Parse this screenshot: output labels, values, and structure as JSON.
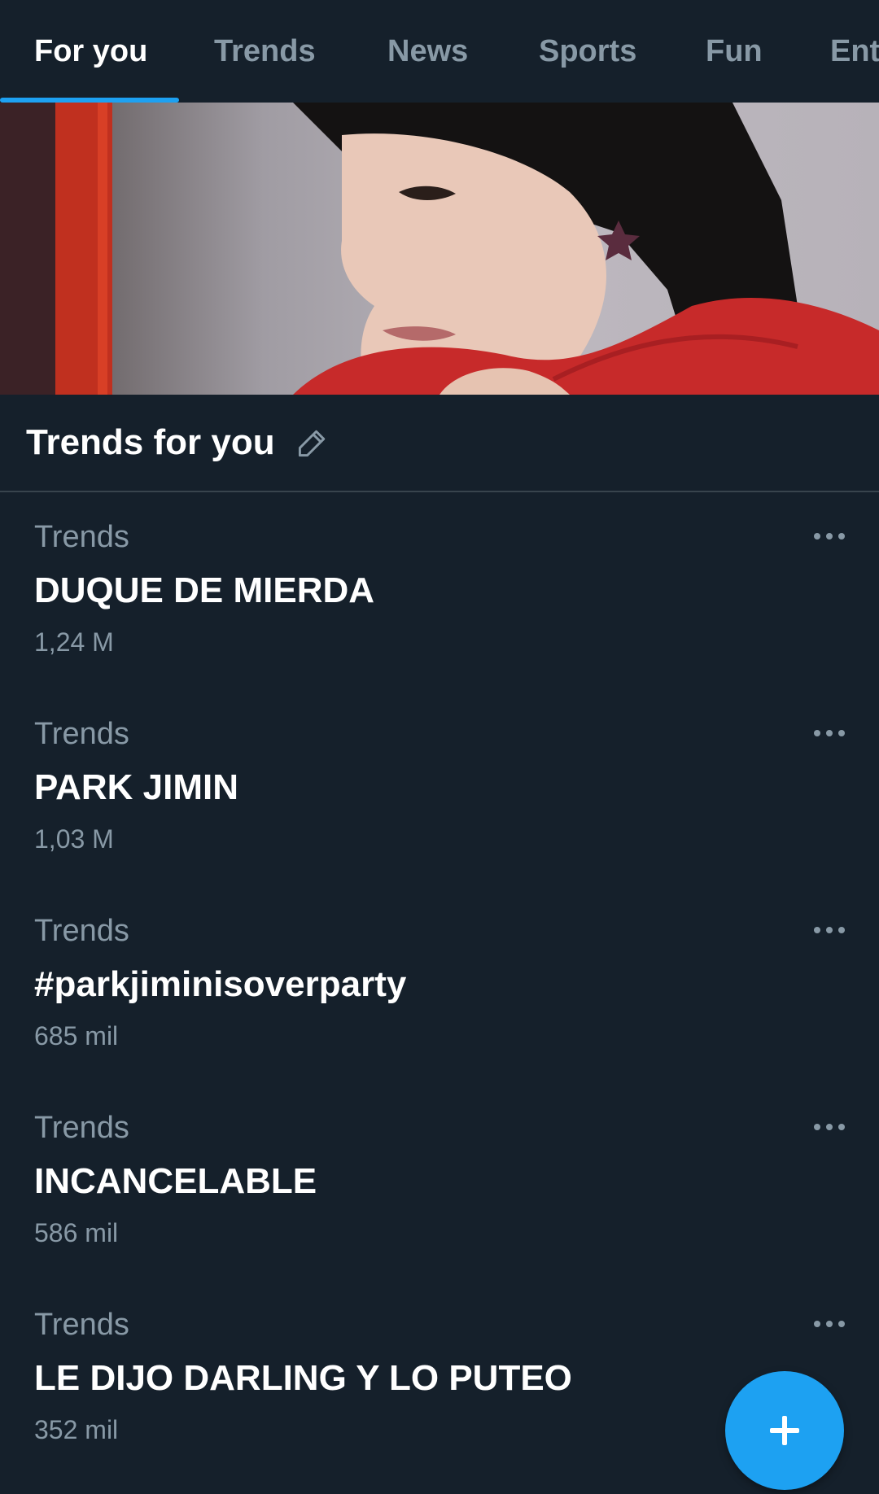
{
  "tabs": [
    {
      "label": "For you",
      "active": true
    },
    {
      "label": "Trends",
      "active": false
    },
    {
      "label": "News",
      "active": false
    },
    {
      "label": "Sports",
      "active": false
    },
    {
      "label": "Fun",
      "active": false
    },
    {
      "label": "Ent",
      "active": false
    }
  ],
  "hero": {
    "icon": "photo-banner"
  },
  "section": {
    "title": "Trends for you",
    "edit_icon": "pencil-icon"
  },
  "trends": [
    {
      "category": "Trends",
      "title": "DUQUE DE MIERDA",
      "count": "1,24 M"
    },
    {
      "category": "Trends",
      "title": "PARK JIMIN",
      "count": "1,03 M"
    },
    {
      "category": "Trends",
      "title": "#parkjiminisoverparty",
      "count": "685 mil"
    },
    {
      "category": "Trends",
      "title": "INCANCELABLE",
      "count": "586 mil"
    },
    {
      "category": "Trends",
      "title": "LE DIJO DARLING Y LO PUTEO",
      "count": "352 mil"
    }
  ],
  "fab": {
    "icon": "plus-icon"
  },
  "colors": {
    "background": "#15202b",
    "accent": "#1da1f2",
    "secondary_text": "#8899a6",
    "divider": "#38444d"
  }
}
